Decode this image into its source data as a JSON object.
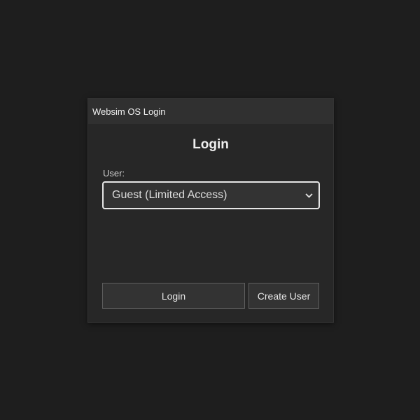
{
  "window": {
    "title": "Websim OS Login"
  },
  "form": {
    "heading": "Login",
    "user_label": "User:",
    "user_select": {
      "selected": "Guest (Limited Access)",
      "icon": "chevron-down-icon"
    }
  },
  "buttons": {
    "login_label": "Login",
    "create_user_label": "Create User"
  }
}
